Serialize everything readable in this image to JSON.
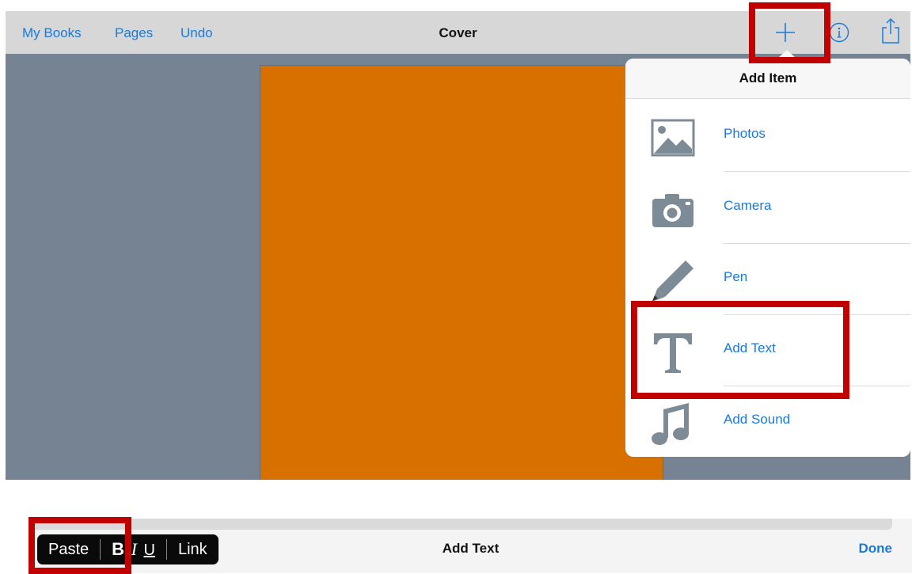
{
  "navbar": {
    "my_books": "My Books",
    "pages": "Pages",
    "undo": "Undo",
    "title": "Cover",
    "icons": [
      "plus-icon",
      "info-icon",
      "share-icon"
    ]
  },
  "cover": {
    "color": "#d87000"
  },
  "popover": {
    "title": "Add Item",
    "items": [
      {
        "label": "Photos",
        "icon": "photos-icon"
      },
      {
        "label": "Camera",
        "icon": "camera-icon"
      },
      {
        "label": "Pen",
        "icon": "pen-icon"
      },
      {
        "label": "Add Text",
        "icon": "text-icon"
      },
      {
        "label": "Add Sound",
        "icon": "music-note-icon"
      }
    ]
  },
  "edit_bar": {
    "paste": "Paste",
    "bold": "B",
    "italic": "I",
    "underline": "U",
    "link": "Link",
    "title": "Add Text",
    "done": "Done"
  },
  "colors": {
    "accent": "#1a7ad9",
    "highlight": "#c10000",
    "background": "#768392",
    "icon_gray": "#7d8b96"
  }
}
